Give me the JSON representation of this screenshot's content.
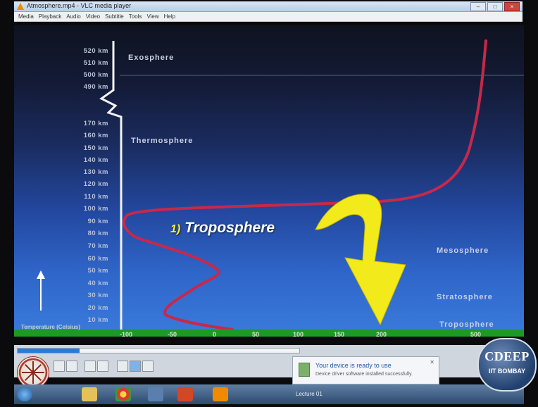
{
  "window": {
    "title": "Atmosphere.mp4 - VLC media player",
    "menu": [
      "Media",
      "Playback",
      "Audio",
      "Video",
      "Subtitle",
      "Tools",
      "View",
      "Help"
    ]
  },
  "slide": {
    "altitude_labels": [
      "520 km",
      "510 km",
      "500 km",
      "490 km",
      "170 km",
      "160 km",
      "150 km",
      "140 km",
      "130 km",
      "120 km",
      "110 km",
      "100 km",
      "90 km",
      "80 km",
      "70 km",
      "60 km",
      "50 km",
      "40 km",
      "30 km",
      "20 km",
      "10 km"
    ],
    "layers": {
      "exosphere": "Exosphere",
      "thermosphere": "Thermosphere",
      "mesosphere": "Mesosphere",
      "stratosphere": "Stratosphere",
      "troposphere": "Troposphere"
    },
    "highlight": {
      "number": "1)",
      "text": "Troposphere"
    },
    "axis_label": "Temperature (Celsius)",
    "temperature_ticks": [
      "-100",
      "-50",
      "0",
      "50",
      "100",
      "150",
      "200",
      "500"
    ]
  },
  "notification": {
    "title": "Your device is ready to use",
    "body": "Device driver software installed successfully."
  },
  "taskbar": {
    "task_label": "Lecture 01"
  },
  "player": {
    "progress": 0.22
  },
  "logos": {
    "cdeep_main": "CDEEP",
    "cdeep_sub": "IIT BOMBAY"
  },
  "colors": {
    "curve": "#c8284a",
    "arrow": "#f3ea1c",
    "ground": "#1d9a24"
  }
}
